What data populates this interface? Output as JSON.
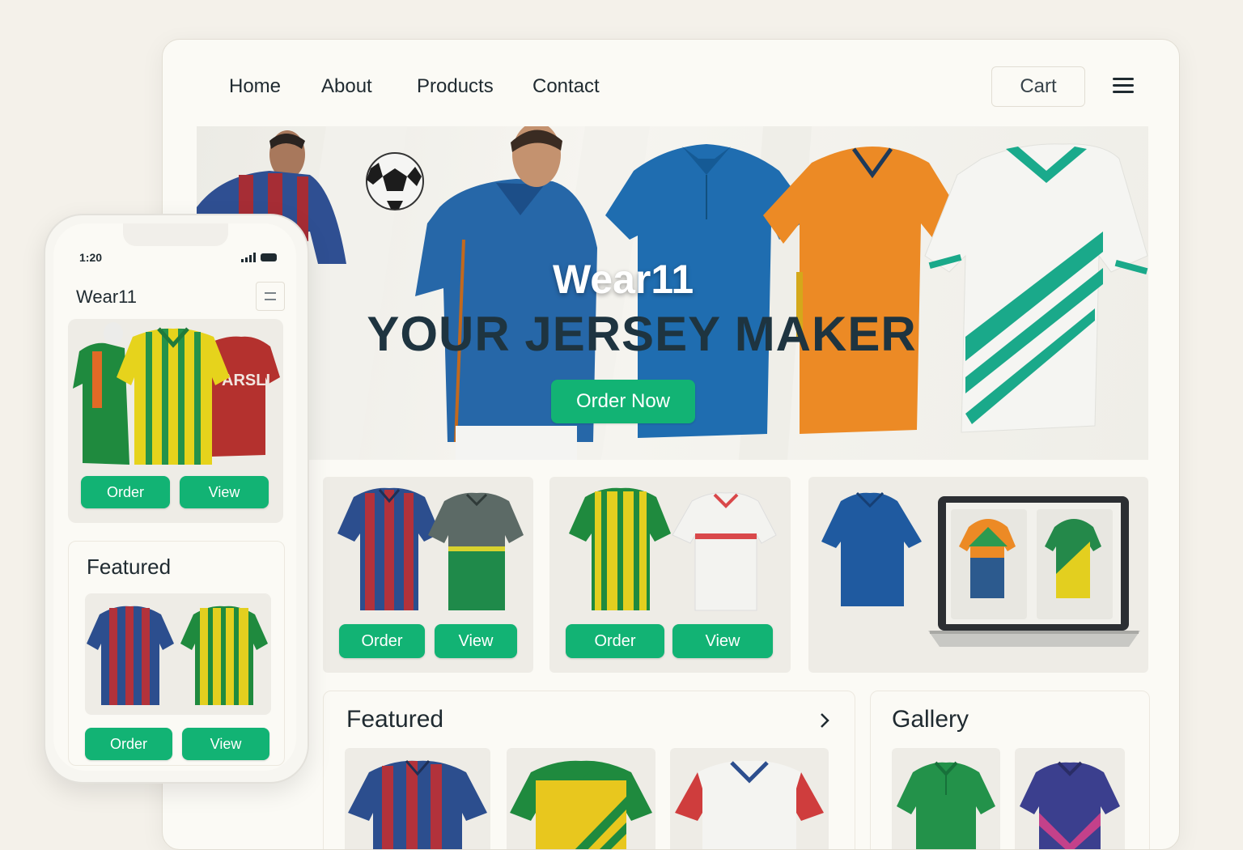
{
  "nav": {
    "links": [
      "Home",
      "About",
      "Products",
      "Contact"
    ],
    "cart": "Cart",
    "menu_icon": "hamburger-icon"
  },
  "hero": {
    "brand": "Wear11",
    "tagline": "YOUR JERSEY MAKER",
    "cta": "Order Now"
  },
  "products": {
    "order_label": "Order",
    "view_label": "View"
  },
  "featured": {
    "title": "Featured",
    "arrow_icon": "chevron-right-icon"
  },
  "gallery": {
    "title": "Gallery"
  },
  "phone": {
    "time": "1:20",
    "app_name": "Wear11",
    "jersey_text": "ARSLI",
    "order_label": "Order",
    "view_label": "View",
    "featured_title": "Featured"
  },
  "colors": {
    "accent": "#12b374",
    "navy": "#1e3440",
    "background": "#f4f1ea"
  }
}
